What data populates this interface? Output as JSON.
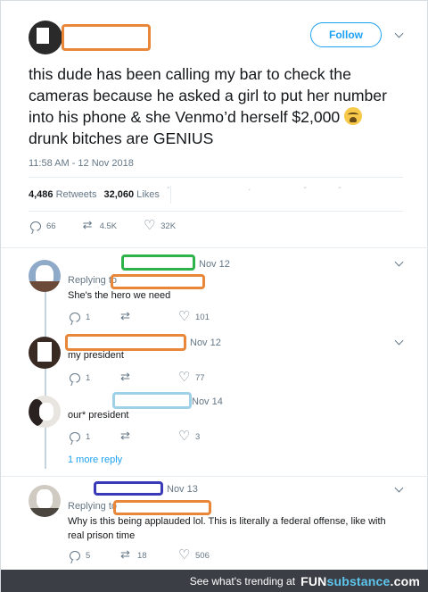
{
  "main_tweet": {
    "follow_label": "Follow",
    "text": "this dude has been calling my bar to check the cameras because he asked a girl to put her number into his phone & she Venmo’d herself $2,000",
    "text_tail": "drunk bitches are GENIUS",
    "emoji": "loudly-crying-face-icon",
    "timestamp": "11:58 AM - 12 Nov 2018",
    "retweets_count": "4,486",
    "retweets_label": "Retweets",
    "likes_count": "32,060",
    "likes_label": "Likes",
    "actions": {
      "replies": "66",
      "retweets": "4.5K",
      "likes": "32K"
    }
  },
  "replies": [
    {
      "date": "Nov 12",
      "replying_to": "Replying to",
      "text": "She's the hero we need",
      "replies": "1",
      "retweets": "",
      "likes": "101"
    },
    {
      "date": "Nov 12",
      "text": "my president",
      "replies": "1",
      "retweets": "",
      "likes": "77"
    },
    {
      "date": "Nov 14",
      "text": "our* president",
      "replies": "1",
      "retweets": "",
      "likes": "3"
    },
    {
      "date": "Nov 13",
      "replying_to": "Replying to",
      "text": "Why is this being applauded lol. This is literally a federal offense, like with real prison time",
      "replies": "5",
      "retweets": "18",
      "likes": "506"
    }
  ],
  "more_reply_label": "1 more reply",
  "footer": {
    "prefix": "See what's trending at",
    "brand_a": "FUN",
    "brand_b": "substance",
    "brand_c": ".com"
  },
  "colors": {
    "accent": "#1da1f2",
    "redact_orange": "#e8873a",
    "redact_green": "#2db34a",
    "redact_lightblue": "#9ed0e8",
    "redact_navy": "#3a3ab8"
  }
}
